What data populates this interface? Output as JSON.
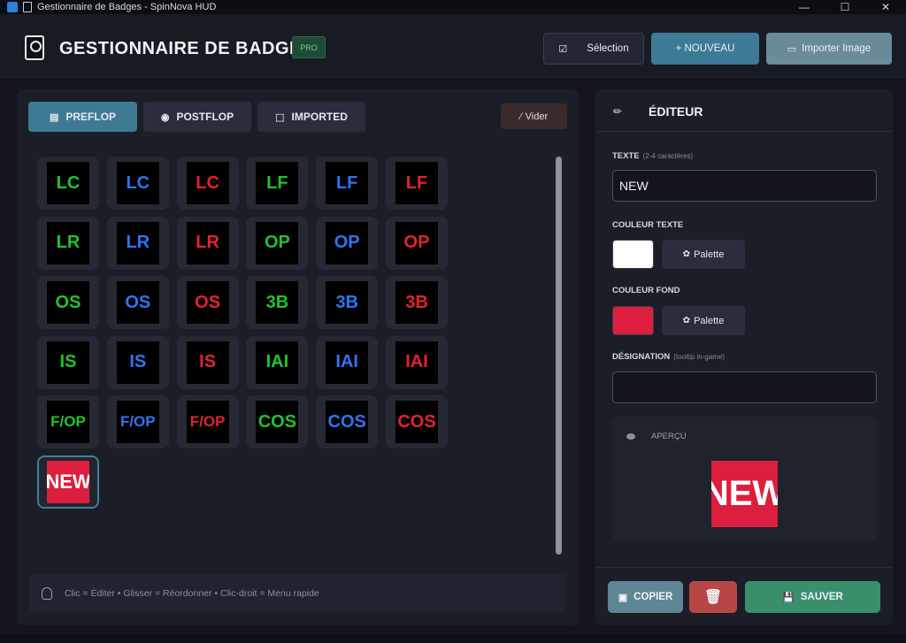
{
  "window": {
    "title": "Gestionnaire de Badges - SpinNova HUD",
    "minimize": "—",
    "maximize": "☐",
    "close": "✕"
  },
  "header": {
    "title": "GESTIONNAIRE DE BADGES",
    "pro_label": "PRO",
    "selection_label": "Sélection",
    "selection_icon": "☑",
    "new_label": "+ NOUVEAU",
    "import_label": "Importer Image",
    "import_icon": "▭"
  },
  "tabs": [
    {
      "label": "PREFLOP",
      "icon": "▤",
      "active": true
    },
    {
      "label": "POSTFLOP",
      "icon": "◉",
      "active": false
    },
    {
      "label": "IMPORTED",
      "icon": "⬚",
      "active": false
    }
  ],
  "clear_label": "Vider",
  "clear_icon": "⁄",
  "badges": [
    {
      "text": "LC",
      "color": "#22c22f"
    },
    {
      "text": "LC",
      "color": "#2f74f0"
    },
    {
      "text": "LC",
      "color": "#e2232c"
    },
    {
      "text": "LF",
      "color": "#22c22f"
    },
    {
      "text": "LF",
      "color": "#2f74f0"
    },
    {
      "text": "LF",
      "color": "#e2232c"
    },
    {
      "text": "LR",
      "color": "#22c22f"
    },
    {
      "text": "LR",
      "color": "#2f74f0"
    },
    {
      "text": "LR",
      "color": "#e2232c"
    },
    {
      "text": "OP",
      "color": "#22c22f"
    },
    {
      "text": "OP",
      "color": "#2f74f0"
    },
    {
      "text": "OP",
      "color": "#e2232c"
    },
    {
      "text": "OS",
      "color": "#22c22f"
    },
    {
      "text": "OS",
      "color": "#2f74f0"
    },
    {
      "text": "OS",
      "color": "#e2232c"
    },
    {
      "text": "3B",
      "color": "#22c22f"
    },
    {
      "text": "3B",
      "color": "#2f74f0"
    },
    {
      "text": "3B",
      "color": "#e2232c"
    },
    {
      "text": "IS",
      "color": "#22c22f"
    },
    {
      "text": "IS",
      "color": "#2f74f0"
    },
    {
      "text": "IS",
      "color": "#e2232c"
    },
    {
      "text": "IAI",
      "color": "#22c22f"
    },
    {
      "text": "IAI",
      "color": "#2f74f0"
    },
    {
      "text": "IAI",
      "color": "#e2232c"
    },
    {
      "text": "F/OP",
      "color": "#22c22f"
    },
    {
      "text": "F/OP",
      "color": "#2f74f0"
    },
    {
      "text": "F/OP",
      "color": "#e2232c"
    },
    {
      "text": "COS",
      "color": "#22c22f"
    },
    {
      "text": "COS",
      "color": "#2f74f0"
    },
    {
      "text": "COS",
      "color": "#e2232c"
    },
    {
      "text": "NEW",
      "color": "#ffffff",
      "bg": "#dc1f3e",
      "selected": true
    }
  ],
  "hint": "Clic = Éditer  •  Glisser = Réordonner  •  Clic-droit = Menu rapide",
  "editor": {
    "title": "ÉDITEUR",
    "icon": "✏",
    "text_label": "TEXTE",
    "text_hint": "(2-4 caractères)",
    "text_value": "NEW",
    "text_color_label": "COULEUR TEXTE",
    "text_color": "#ffffff",
    "bg_color_label": "COULEUR FOND",
    "bg_color": "#dc1f3e",
    "palette_label": "Palette",
    "palette_icon": "✿",
    "designation_label": "DÉSIGNATION",
    "designation_hint": "(tooltip in-game)",
    "designation_value": "",
    "preview_label": "APERÇU",
    "preview_text": "NEW",
    "copy_label": "COPIER",
    "copy_icon": "▣",
    "delete_icon": "🗑",
    "save_label": "SAUVER",
    "save_icon": "💾"
  }
}
